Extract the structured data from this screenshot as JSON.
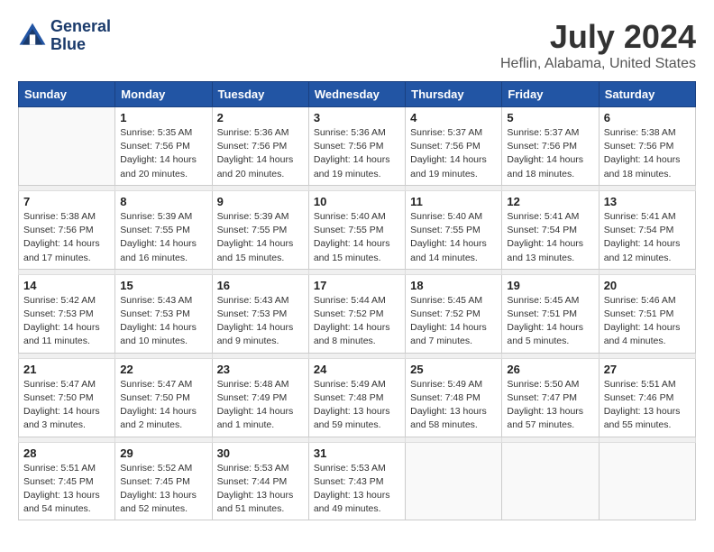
{
  "header": {
    "logo_line1": "General",
    "logo_line2": "Blue",
    "main_title": "July 2024",
    "subtitle": "Heflin, Alabama, United States"
  },
  "days_of_week": [
    "Sunday",
    "Monday",
    "Tuesday",
    "Wednesday",
    "Thursday",
    "Friday",
    "Saturday"
  ],
  "weeks": [
    [
      {
        "day": "",
        "detail": ""
      },
      {
        "day": "1",
        "detail": "Sunrise: 5:35 AM\nSunset: 7:56 PM\nDaylight: 14 hours\nand 20 minutes."
      },
      {
        "day": "2",
        "detail": "Sunrise: 5:36 AM\nSunset: 7:56 PM\nDaylight: 14 hours\nand 20 minutes."
      },
      {
        "day": "3",
        "detail": "Sunrise: 5:36 AM\nSunset: 7:56 PM\nDaylight: 14 hours\nand 19 minutes."
      },
      {
        "day": "4",
        "detail": "Sunrise: 5:37 AM\nSunset: 7:56 PM\nDaylight: 14 hours\nand 19 minutes."
      },
      {
        "day": "5",
        "detail": "Sunrise: 5:37 AM\nSunset: 7:56 PM\nDaylight: 14 hours\nand 18 minutes."
      },
      {
        "day": "6",
        "detail": "Sunrise: 5:38 AM\nSunset: 7:56 PM\nDaylight: 14 hours\nand 18 minutes."
      }
    ],
    [
      {
        "day": "7",
        "detail": "Sunrise: 5:38 AM\nSunset: 7:56 PM\nDaylight: 14 hours\nand 17 minutes."
      },
      {
        "day": "8",
        "detail": "Sunrise: 5:39 AM\nSunset: 7:55 PM\nDaylight: 14 hours\nand 16 minutes."
      },
      {
        "day": "9",
        "detail": "Sunrise: 5:39 AM\nSunset: 7:55 PM\nDaylight: 14 hours\nand 15 minutes."
      },
      {
        "day": "10",
        "detail": "Sunrise: 5:40 AM\nSunset: 7:55 PM\nDaylight: 14 hours\nand 15 minutes."
      },
      {
        "day": "11",
        "detail": "Sunrise: 5:40 AM\nSunset: 7:55 PM\nDaylight: 14 hours\nand 14 minutes."
      },
      {
        "day": "12",
        "detail": "Sunrise: 5:41 AM\nSunset: 7:54 PM\nDaylight: 14 hours\nand 13 minutes."
      },
      {
        "day": "13",
        "detail": "Sunrise: 5:41 AM\nSunset: 7:54 PM\nDaylight: 14 hours\nand 12 minutes."
      }
    ],
    [
      {
        "day": "14",
        "detail": "Sunrise: 5:42 AM\nSunset: 7:53 PM\nDaylight: 14 hours\nand 11 minutes."
      },
      {
        "day": "15",
        "detail": "Sunrise: 5:43 AM\nSunset: 7:53 PM\nDaylight: 14 hours\nand 10 minutes."
      },
      {
        "day": "16",
        "detail": "Sunrise: 5:43 AM\nSunset: 7:53 PM\nDaylight: 14 hours\nand 9 minutes."
      },
      {
        "day": "17",
        "detail": "Sunrise: 5:44 AM\nSunset: 7:52 PM\nDaylight: 14 hours\nand 8 minutes."
      },
      {
        "day": "18",
        "detail": "Sunrise: 5:45 AM\nSunset: 7:52 PM\nDaylight: 14 hours\nand 7 minutes."
      },
      {
        "day": "19",
        "detail": "Sunrise: 5:45 AM\nSunset: 7:51 PM\nDaylight: 14 hours\nand 5 minutes."
      },
      {
        "day": "20",
        "detail": "Sunrise: 5:46 AM\nSunset: 7:51 PM\nDaylight: 14 hours\nand 4 minutes."
      }
    ],
    [
      {
        "day": "21",
        "detail": "Sunrise: 5:47 AM\nSunset: 7:50 PM\nDaylight: 14 hours\nand 3 minutes."
      },
      {
        "day": "22",
        "detail": "Sunrise: 5:47 AM\nSunset: 7:50 PM\nDaylight: 14 hours\nand 2 minutes."
      },
      {
        "day": "23",
        "detail": "Sunrise: 5:48 AM\nSunset: 7:49 PM\nDaylight: 14 hours\nand 1 minute."
      },
      {
        "day": "24",
        "detail": "Sunrise: 5:49 AM\nSunset: 7:48 PM\nDaylight: 13 hours\nand 59 minutes."
      },
      {
        "day": "25",
        "detail": "Sunrise: 5:49 AM\nSunset: 7:48 PM\nDaylight: 13 hours\nand 58 minutes."
      },
      {
        "day": "26",
        "detail": "Sunrise: 5:50 AM\nSunset: 7:47 PM\nDaylight: 13 hours\nand 57 minutes."
      },
      {
        "day": "27",
        "detail": "Sunrise: 5:51 AM\nSunset: 7:46 PM\nDaylight: 13 hours\nand 55 minutes."
      }
    ],
    [
      {
        "day": "28",
        "detail": "Sunrise: 5:51 AM\nSunset: 7:45 PM\nDaylight: 13 hours\nand 54 minutes."
      },
      {
        "day": "29",
        "detail": "Sunrise: 5:52 AM\nSunset: 7:45 PM\nDaylight: 13 hours\nand 52 minutes."
      },
      {
        "day": "30",
        "detail": "Sunrise: 5:53 AM\nSunset: 7:44 PM\nDaylight: 13 hours\nand 51 minutes."
      },
      {
        "day": "31",
        "detail": "Sunrise: 5:53 AM\nSunset: 7:43 PM\nDaylight: 13 hours\nand 49 minutes."
      },
      {
        "day": "",
        "detail": ""
      },
      {
        "day": "",
        "detail": ""
      },
      {
        "day": "",
        "detail": ""
      }
    ]
  ]
}
